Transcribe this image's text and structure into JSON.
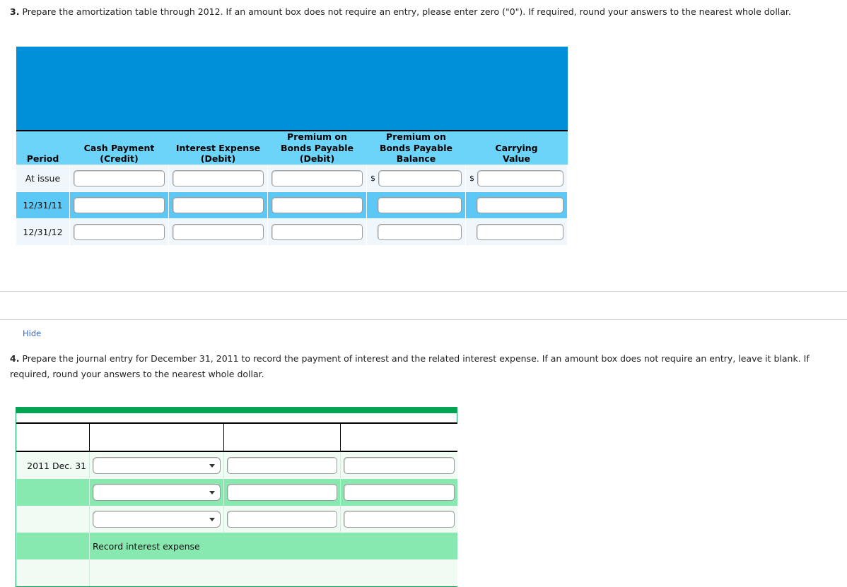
{
  "questions": {
    "q3": {
      "number": "3.",
      "text": "Prepare the amortization table through 2012. If an amount box does not require an entry, please enter zero (\"0\"). If required, round your answers to the nearest whole dollar."
    },
    "q4": {
      "number": "4.",
      "text": "Prepare the journal entry for December 31, 2011 to record the payment of interest and the related interest expense. If an amount box does not require an entry, leave it blank. If required, round your answers to the nearest whole dollar."
    }
  },
  "hide_link": {
    "label": "Hide"
  },
  "amortization_table": {
    "banner_color": "#0090da",
    "header_color": "#6bd4f8",
    "row_light_color": "#eff7fd",
    "row_dark_color": "#5bc8f5",
    "headers": [
      "Period",
      "Cash Payment\n(Credit)",
      "Interest Expense\n(Debit)",
      "Premium on\nBonds Payable\n(Debit)",
      "Premium on\nBonds Payable\nBalance",
      "Carrying\nValue"
    ],
    "headers_lines": {
      "period": [
        "Period"
      ],
      "cash_payment": [
        "Cash Payment",
        "(Credit)"
      ],
      "interest_expense": [
        "Interest Expense",
        "(Debit)"
      ],
      "premium_debit": [
        "Premium on",
        "Bonds Payable",
        "(Debit)"
      ],
      "premium_balance": [
        "Premium on",
        "Bonds Payable",
        "Balance"
      ],
      "carrying_value": [
        "Carrying",
        "Value"
      ]
    },
    "currency_symbol": "$",
    "rows": [
      {
        "period": "At issue",
        "shade": "light",
        "cash_payment": "",
        "interest_expense": "",
        "premium_debit": "",
        "premium_balance": "",
        "carrying_value": "",
        "show_dollar_premium_balance": true,
        "show_dollar_carrying_value": true
      },
      {
        "period": "12/31/11",
        "shade": "dark",
        "cash_payment": "",
        "interest_expense": "",
        "premium_debit": "",
        "premium_balance": "",
        "carrying_value": "",
        "show_dollar_premium_balance": false,
        "show_dollar_carrying_value": false
      },
      {
        "period": "12/31/12",
        "shade": "light",
        "cash_payment": "",
        "interest_expense": "",
        "premium_debit": "",
        "premium_balance": "",
        "carrying_value": "",
        "show_dollar_premium_balance": false,
        "show_dollar_carrying_value": false
      }
    ]
  },
  "journal_table": {
    "banner_color": "#00a551",
    "row_light_color": "#effbf3",
    "row_mid_color": "#87e8b0",
    "border_color": "#13a05a",
    "rows": [
      {
        "date": "2011 Dec. 31",
        "shade": "light",
        "account": "",
        "debit": "",
        "credit": ""
      },
      {
        "date": "",
        "shade": "mid",
        "account": "",
        "debit": "",
        "credit": ""
      },
      {
        "date": "",
        "shade": "light",
        "account": "",
        "debit": "",
        "credit": ""
      }
    ],
    "memo": {
      "text": "Record interest expense",
      "shade": "mid"
    }
  }
}
